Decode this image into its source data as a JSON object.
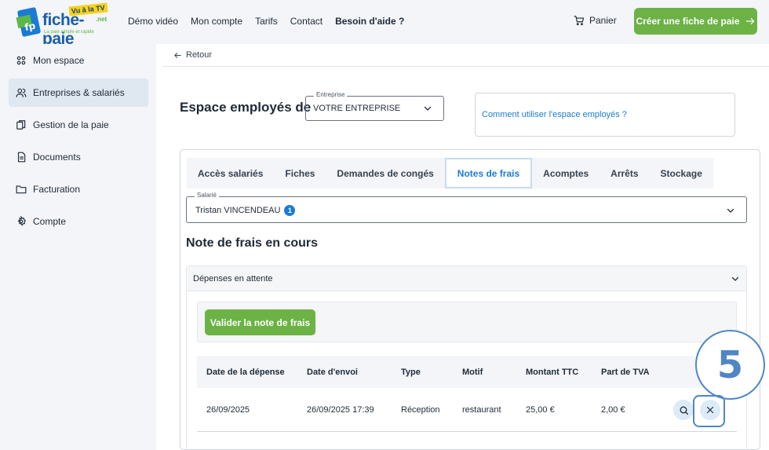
{
  "brand": {
    "name": "fiche-paie",
    "tv_badge": "Vu à la TV",
    "net": ".net",
    "tagline": "La paie simple et rapide"
  },
  "topnav": {
    "items": [
      "Démo vidéo",
      "Mon compte",
      "Tarifs",
      "Contact",
      "Besoin d'aide ?"
    ],
    "cart": "Panier",
    "cta": "Créer une fiche de paie"
  },
  "sidebar": {
    "items": [
      {
        "label": "Mon espace",
        "icon": "grid-icon"
      },
      {
        "label": "Entreprises & salariés",
        "icon": "users-icon",
        "active": true
      },
      {
        "label": "Gestion de la paie",
        "icon": "files-icon"
      },
      {
        "label": "Documents",
        "icon": "document-icon"
      },
      {
        "label": "Facturation",
        "icon": "folder-icon"
      },
      {
        "label": "Compte",
        "icon": "gear-icon"
      }
    ]
  },
  "main": {
    "back": "Retour",
    "title": "Espace employés de",
    "entreprise": {
      "label": "Entreprise",
      "value": "VOTRE ENTREPRISE"
    },
    "howto": "Comment utiliser l'espace employés ?",
    "tabs": [
      {
        "label": "Accès salariés"
      },
      {
        "label": "Fiches"
      },
      {
        "label": "Demandes de congés"
      },
      {
        "label": "Notes de frais",
        "active": true
      },
      {
        "label": "Acomptes"
      },
      {
        "label": "Arrêts"
      },
      {
        "label": "Stockage"
      }
    ],
    "salarie": {
      "label": "Salarié",
      "value": "Tristan VINCENDEAU",
      "badge": "1"
    },
    "section_title": "Note de frais en cours",
    "accordion": "Dépenses en attente",
    "validate_button": "Valider la note de frais",
    "table": {
      "headers": [
        "Date de la dépense",
        "Date d'envoi",
        "Type",
        "Motif",
        "Montant TTC",
        "Part de TVA"
      ],
      "rows": [
        [
          "26/09/2025",
          "26/09/2025 17:39",
          "Réception",
          "restaurant",
          "25,00 €",
          "2,00 €"
        ]
      ]
    }
  },
  "step_number": "5",
  "colors": {
    "accent": "#1b7bd4",
    "green": "#6cb245",
    "highlight": "#4f86c6"
  }
}
